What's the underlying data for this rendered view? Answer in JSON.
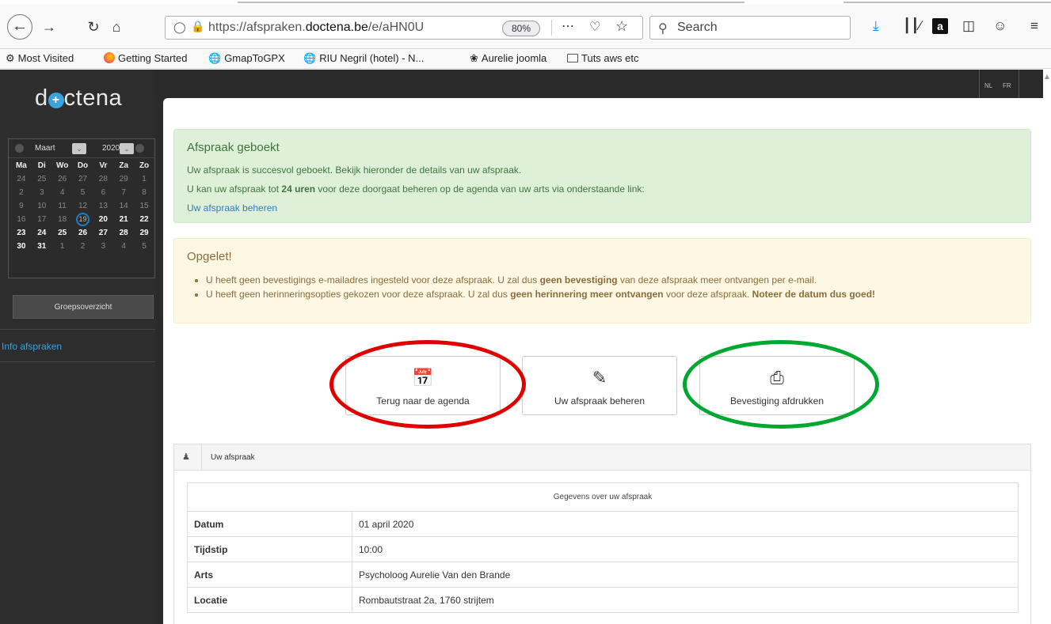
{
  "browser": {
    "url_prefix": "https://afspraken.",
    "url_domain": "doctena.be",
    "url_path": "/e/aHN0U",
    "zoom": "80%",
    "search_placeholder": "Search",
    "bookmarks": [
      {
        "label": "Most Visited",
        "icon": "gear-icon"
      },
      {
        "label": "Getting Started",
        "icon": "firefox-icon"
      },
      {
        "label": "GmapToGPX",
        "icon": "globe-icon"
      },
      {
        "label": "RIU Negril (hotel) - N...",
        "icon": "globe-icon"
      },
      {
        "label": "Aurelie joomla",
        "icon": "joomla-icon"
      },
      {
        "label": "Tuts aws etc",
        "icon": "folder-icon"
      }
    ]
  },
  "site": {
    "logo_pre": "d",
    "logo_post": "ctena",
    "lang_nl": "NL",
    "lang_fr": "FR"
  },
  "calendar": {
    "month": "Maart",
    "year": "2020",
    "weekdays": [
      "Ma",
      "Di",
      "Wo",
      "Do",
      "Vr",
      "Za",
      "Zo"
    ],
    "weeks": [
      [
        "24",
        "25",
        "26",
        "27",
        "28",
        "29",
        "1"
      ],
      [
        "2",
        "3",
        "4",
        "5",
        "6",
        "7",
        "8"
      ],
      [
        "9",
        "10",
        "11",
        "12",
        "13",
        "14",
        "15"
      ],
      [
        "16",
        "17",
        "18",
        "19",
        "20",
        "21",
        "22"
      ],
      [
        "23",
        "24",
        "25",
        "26",
        "27",
        "28",
        "29"
      ],
      [
        "30",
        "31",
        "1",
        "2",
        "3",
        "4",
        "5"
      ]
    ],
    "today": "19"
  },
  "sidebar": {
    "group_button": "Groepsoverzicht",
    "info_link": "Info afspraken"
  },
  "success": {
    "title": "Afspraak geboekt",
    "line1": "Uw afspraak is succesvol geboekt. Bekijk hieronder de details van uw afspraak.",
    "line2_pre": "U kan uw afspraak tot ",
    "line2_bold": "24 uren",
    "line2_post": " voor deze doorgaat beheren op de agenda van uw arts via onderstaande link:",
    "link": "Uw afspraak beheren"
  },
  "warning": {
    "title": "Opgelet!",
    "item1_pre": "U heeft geen bevestigings e-mailadres ingesteld voor deze afspraak. U zal dus ",
    "item1_bold": "geen bevestiging",
    "item1_post": " van deze afspraak meer ontvangen per e-mail.",
    "item2_pre": "U heeft geen herinneringsopties gekozen voor deze afspraak. U zal dus ",
    "item2_bold": "geen herinnering meer ontvangen",
    "item2_mid": " voor deze afspraak. ",
    "item2_bold2": "Noteer de datum dus goed!"
  },
  "actions": {
    "back": "Terug naar de agenda",
    "manage": "Uw afspraak beheren",
    "print": "Bevestiging afdrukken"
  },
  "appointment": {
    "panel_title": "Uw afspraak",
    "table_header": "Gegevens over uw afspraak",
    "rows": [
      {
        "key": "Datum",
        "value": "01 april 2020"
      },
      {
        "key": "Tijdstip",
        "value": "10:00"
      },
      {
        "key": "Arts",
        "value": "Psycholoog Aurelie Van den Brande"
      },
      {
        "key": "Locatie",
        "value": "Rombautstraat 2a, 1760 strijtem"
      }
    ]
  },
  "colors": {
    "highlight_red": "#e00000",
    "highlight_green": "#00a832",
    "brand_blue": "#3aa3dd"
  }
}
